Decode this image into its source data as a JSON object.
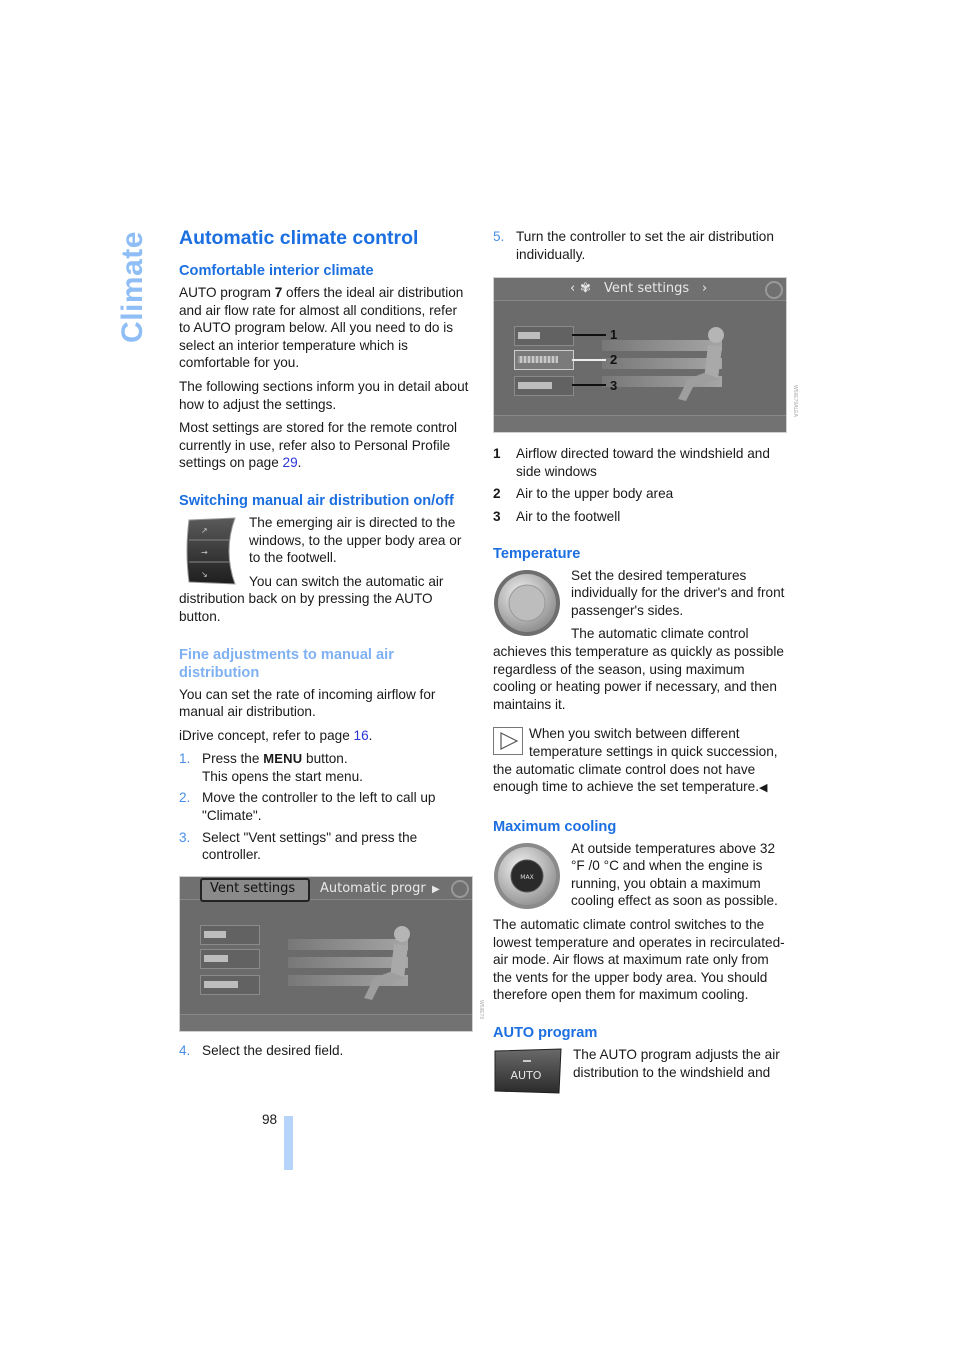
{
  "side_tab": {
    "label": "Climate"
  },
  "left": {
    "title": "Automatic climate control",
    "comfortable": {
      "heading": "Comfortable interior climate",
      "p1_before": "AUTO program ",
      "p1_bold": "7",
      "p1_after": " offers the ideal air distribution and air flow rate for almost all conditions, refer to AUTO program below. All you need to do is select an interior temperature which is comfortable for you.",
      "p2": "The following sections inform you in detail about how to adjust the settings.",
      "p3_before": "Most settings are stored for the remote control currently in use, refer also to Personal Profile settings on page ",
      "p3_link": "29",
      "p3_after": "."
    },
    "switching": {
      "heading": "Switching manual air distribution on/off",
      "image_icon": "air-distribution-buttons-icon",
      "p1": "The emerging air is directed to the windows, to the upper body area or to the footwell.",
      "p2": "You can switch the automatic air distribution back on by pressing the AUTO button."
    },
    "fine": {
      "heading": "Fine adjustments to manual air distribution",
      "p1": "You can set the rate of incoming airflow for manual air distribution.",
      "p2_before": "iDrive concept, refer to page ",
      "p2_link": "16",
      "p2_after": ".",
      "steps": [
        {
          "n": "1.",
          "before": "Press the ",
          "bold": "MENU",
          "after": " button.",
          "line2": "This opens the start menu."
        },
        {
          "n": "2.",
          "text": "Move the controller to the left to call up \"Climate\"."
        },
        {
          "n": "3.",
          "text": "Select \"Vent settings\" and press the controller."
        }
      ]
    },
    "screen1": {
      "tab_active": "Vent settings",
      "tab_next": "Automatic progr",
      "arrow": "▶",
      "image_code": "W5IIE79"
    },
    "step4": {
      "n": "4.",
      "text": "Select the desired field."
    }
  },
  "right": {
    "step5": {
      "n": "5.",
      "text": "Turn the controller to set the air distribution individually."
    },
    "screen2": {
      "title": "Vent settings",
      "left_arrow": "‹",
      "right_arrow": "›",
      "callouts": [
        "1",
        "2",
        "3"
      ],
      "image_code": "W5IIE79ALEA"
    },
    "legend": [
      {
        "n": "1",
        "text": "Airflow directed toward the windshield and side windows"
      },
      {
        "n": "2",
        "text": "Air to the upper body area"
      },
      {
        "n": "3",
        "text": "Air to the footwell"
      }
    ],
    "temperature": {
      "heading": "Temperature",
      "image_icon": "temperature-knob-icon",
      "p1": "Set the desired temperatures individually for the driver's and front passenger's sides.",
      "p2": "The automatic climate control achieves this temperature as quickly as possible regardless of the season, using maximum cooling or heating power if necessary, and then maintains it.",
      "note": "When you switch between different temperature settings in quick succession, the automatic climate control does not have enough time to achieve the set temperature.",
      "note_end": "◀"
    },
    "max_cooling": {
      "heading": "Maximum cooling",
      "image_icon": "max-cooling-button-icon",
      "button_label": "MAX",
      "p1": "At outside temperatures above 32 °F /0 °C and when the engine is running, you obtain a maximum cooling effect as soon as possible.",
      "p2": "The automatic climate control switches to the lowest temperature and operates in recirculated-air mode. Air flows at maximum rate only from the vents for the upper body area. You should therefore open them for maximum cooling."
    },
    "auto_program": {
      "heading": "AUTO program",
      "button_label": "AUTO",
      "p1": "The AUTO program adjusts the air distribution to the windshield and"
    }
  },
  "footer": {
    "page_number": "98"
  }
}
